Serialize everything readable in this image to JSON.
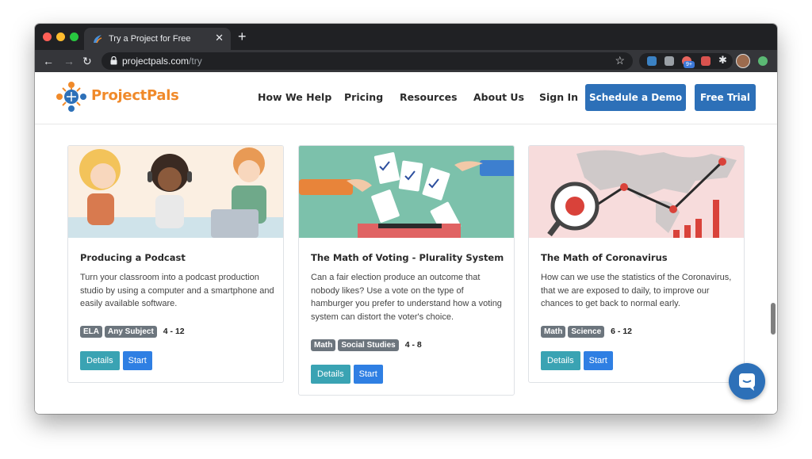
{
  "browser": {
    "tab_title": "Try a Project for Free",
    "tab_close": "✕",
    "new_tab": "+",
    "url_domain": "projectpals.com",
    "url_path": "/try",
    "ext_badge": "9+"
  },
  "site": {
    "logo_text": "ProjectPals",
    "nav": [
      "How We Help",
      "Pricing",
      "Resources",
      "About Us",
      "Sign In"
    ],
    "schedule_demo": "Schedule a Demo",
    "free_trial": "Free Trial"
  },
  "cards": [
    {
      "title": "Producing a Podcast",
      "description": "Turn your classroom into a podcast production studio by using a computer and a smartphone and easily available software.",
      "tags": [
        "ELA",
        "Any Subject"
      ],
      "grades": "4 - 12",
      "details_label": "Details",
      "start_label": "Start"
    },
    {
      "title": "The Math of Voting - Plurality System",
      "description": "Can a fair election produce an outcome that nobody likes? Use a vote on the type of hamburger you prefer to understand how a voting system can distort the voter's choice.",
      "tags": [
        "Math",
        "Social Studies"
      ],
      "grades": "4 - 8",
      "details_label": "Details",
      "start_label": "Start"
    },
    {
      "title": "The Math of Coronavirus",
      "description": "How can we use the statistics of the Coronavirus, that we are exposed to daily, to improve our chances to get back to normal early.",
      "tags": [
        "Math",
        "Science"
      ],
      "grades": "6 - 12",
      "details_label": "Details",
      "start_label": "Start"
    }
  ],
  "colors": {
    "brand_orange": "#f08a2a",
    "brand_blue": "#2d70b8",
    "details_teal": "#3aa3b3",
    "start_blue": "#2f7fe3",
    "tag_gray": "#6c757d"
  },
  "icons": {
    "back": "back-arrow-icon",
    "forward": "forward-arrow-icon",
    "reload": "reload-icon",
    "lock": "lock-icon",
    "bookmark": "star-icon",
    "extensions": "puzzle-icon",
    "chat": "chat-icon"
  }
}
